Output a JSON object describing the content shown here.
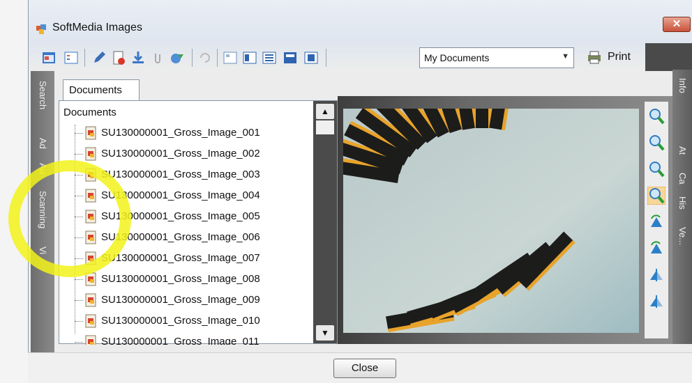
{
  "window": {
    "title": "SoftMedia Images",
    "close_glyph": "✕"
  },
  "toolbar": {
    "location": "My Documents",
    "print_label": "Print",
    "icons": [
      "new-window-icon",
      "grid-icon",
      "edit-icon",
      "document-delete-icon",
      "download-icon",
      "attach-icon",
      "export-icon",
      "refresh-icon",
      "view-thumbs-icon",
      "view-details-icon",
      "view-list-icon",
      "view-tiles-icon",
      "view-single-icon"
    ]
  },
  "side_tabs": {
    "left": [
      "Search",
      "Ad",
      "Au",
      "Scanning",
      "Vi"
    ],
    "right": [
      "Info",
      "At",
      "Ca",
      "His",
      "Ve..."
    ]
  },
  "tab": {
    "label": "Documents"
  },
  "tree": {
    "header": "Documents",
    "items": [
      "SU130000001_Gross_Image_001",
      "SU130000001_Gross_Image_002",
      "SU130000001_Gross_Image_003",
      "SU130000001_Gross_Image_004",
      "SU130000001_Gross_Image_005",
      "SU130000001_Gross_Image_006",
      "SU130000001_Gross_Image_007",
      "SU130000001_Gross_Image_008",
      "SU130000001_Gross_Image_009",
      "SU130000001_Gross_Image_010",
      "SU130000001_Gross_Image_011"
    ]
  },
  "preview": {
    "zoom_tools": [
      "zoom-in-icon",
      "zoom-out-icon",
      "zoom-fit-icon",
      "zoom-actual-icon",
      "rotate-right-icon",
      "rotate-left-icon",
      "flip-vertical-icon",
      "flip-horizontal-icon"
    ]
  },
  "footer": {
    "close_label": "Close"
  },
  "colors": {
    "highlight": "#f2f21a",
    "accent": "#e8a32a",
    "slate": "#4b4b4b"
  }
}
